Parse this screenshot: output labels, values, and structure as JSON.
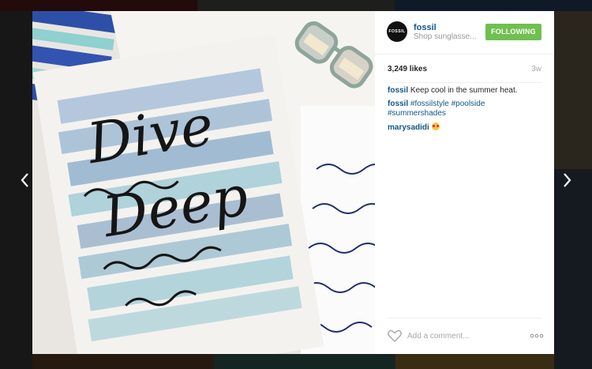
{
  "post": {
    "username": "fossil",
    "location": "Shop sunglasse...",
    "follow_label": "FOLLOWING",
    "avatar_text": "FOSSIL",
    "likes": "3,249 likes",
    "age": "3w"
  },
  "comments": [
    {
      "user": "fossil",
      "text": " Keep cool in the summer heat."
    },
    {
      "user": "fossil",
      "hashtags": "#fossilstyle #poolside #summershades"
    },
    {
      "user": "marysadidi"
    }
  ],
  "comment_input": {
    "placeholder": "Add a comment..."
  },
  "more_label": "∘∘∘",
  "photo": {
    "lettering": [
      "Dive",
      "Deep"
    ]
  },
  "colors": {
    "link": "#125688",
    "follow_green": "#70c050",
    "muted": "#a5a7aa"
  },
  "icons": [
    "chevron-left-icon",
    "chevron-right-icon",
    "heart-icon",
    "more-options-icon",
    "smiling-heart-eyes-emoji-icon"
  ]
}
